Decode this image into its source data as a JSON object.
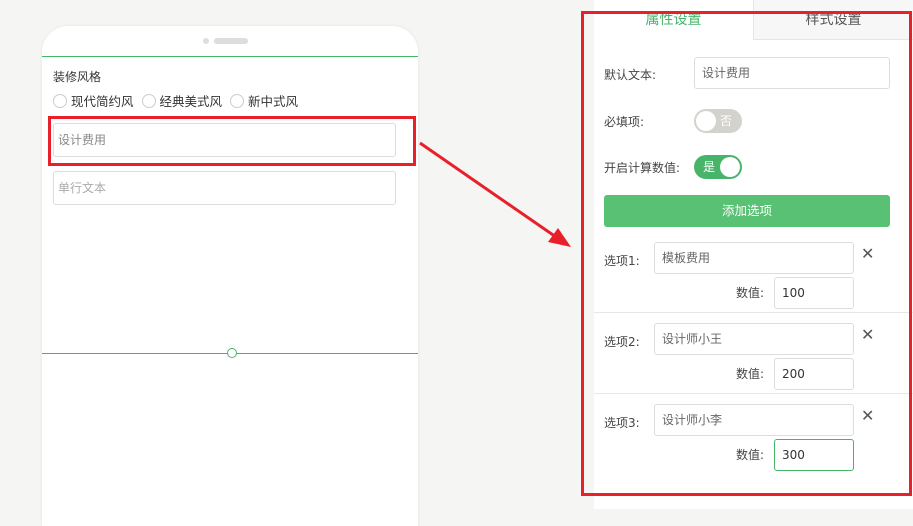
{
  "phone": {
    "style_title": "装修风格",
    "radio_options": [
      "现代简约风",
      "经典美式风",
      "新中式风"
    ],
    "field1_text": "设计费用",
    "field2_placeholder": "单行文本"
  },
  "panel": {
    "tabs": [
      "属性设置",
      "样式设置"
    ],
    "default_text_label": "默认文本:",
    "default_text_value": "设计费用",
    "required_label": "必填项:",
    "required_toggle_text": "否",
    "calc_label": "开启计算数值:",
    "calc_toggle_text": "是",
    "add_button": "添加选项",
    "value_label": "数值:",
    "options": [
      {
        "label": "选项1:",
        "name": "模板费用",
        "value": "100"
      },
      {
        "label": "选项2:",
        "name": "设计师小王",
        "value": "200"
      },
      {
        "label": "选项3:",
        "name": "设计师小李",
        "value": "300"
      }
    ],
    "close_glyph": "✕"
  },
  "colors": {
    "accent": "#48b46a",
    "highlight": "#e8202a"
  }
}
